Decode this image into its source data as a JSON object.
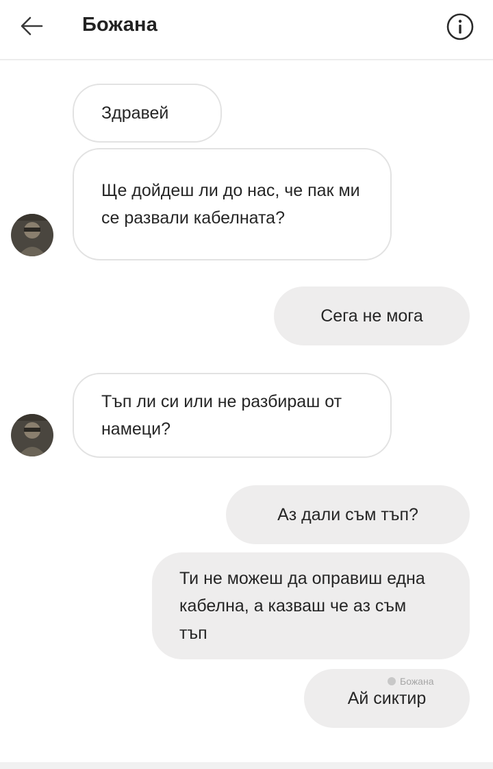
{
  "header": {
    "back_icon": "arrow-left-icon",
    "title": "Божана",
    "info_icon": "info-circle-icon"
  },
  "messages": [
    {
      "direction": "incoming",
      "text": "Здравей"
    },
    {
      "direction": "incoming",
      "text": "Ще дойдеш ли до нас, че пак ми се развали кабелната?"
    },
    {
      "direction": "outgoing",
      "text": "Сега не мога"
    },
    {
      "direction": "incoming",
      "text": "Тъп ли си или не разбираш от намеци?"
    },
    {
      "direction": "outgoing",
      "text": "Аз дали съм тъп?"
    },
    {
      "direction": "outgoing",
      "text": "Ти не можеш да оправиш една кабелна, а казваш че аз съм тъп"
    },
    {
      "direction": "outgoing",
      "text": "Ай сиктир"
    }
  ],
  "seen": {
    "label": "Божана"
  }
}
